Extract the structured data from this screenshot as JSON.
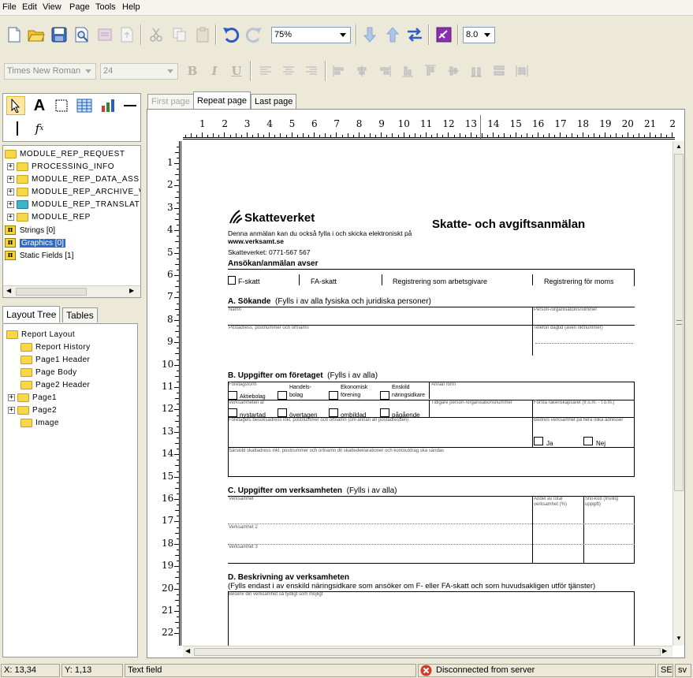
{
  "menu": [
    "File",
    "Edit",
    "View",
    "Page",
    "Tools",
    "Help"
  ],
  "toolbar": {
    "zoom": "75%",
    "version": "8.0"
  },
  "format": {
    "font": "Times New Roman",
    "size": "24",
    "bold": "B",
    "italic": "I",
    "underline": "U"
  },
  "tree": {
    "root": "MODULE_REP_REQUEST",
    "items": [
      "PROCESSING_INFO",
      "MODULE_REP_DATA_ASS",
      "MODULE_REP_ARCHIVE_V",
      "MODULE_REP_TRANSLAT",
      "MODULE_REP"
    ],
    "strings": "Strings [0]",
    "graphics": "Graphics [0]",
    "static": "Static Fields [1]"
  },
  "lowertabs": [
    "Layout Tree",
    "Tables"
  ],
  "layout": {
    "root": "Report Layout",
    "items": [
      "Report History",
      "Page1 Header",
      "Page Body",
      "Page2 Header",
      "Page1",
      "Page2",
      "Image"
    ]
  },
  "pagetabs": [
    "First page",
    "Repeat page",
    "Last page"
  ],
  "ruler_h": [
    "1",
    "2",
    "3",
    "4",
    "5",
    "6",
    "7",
    "8",
    "9",
    "10",
    "11",
    "12",
    "13",
    "14",
    "15",
    "16",
    "17",
    "18",
    "19",
    "20",
    "21",
    "2"
  ],
  "ruler_v": [
    "1",
    "2",
    "3",
    "4",
    "5",
    "6",
    "7",
    "8",
    "9",
    "10",
    "11",
    "12",
    "13",
    "14",
    "15",
    "16",
    "17",
    "18",
    "19",
    "20",
    "21",
    "22"
  ],
  "form": {
    "logo": "Skatteverket",
    "title": "Skatte- och avgiftsanmälan",
    "intro1": "Denna anmälan kan du också fylla i och skicka elektroniskt på",
    "intro2": "www.verksamt.se",
    "intro3": "Skatteverket: 0771-567 567",
    "purpose": "Ansökan/anmälan avser",
    "opts": [
      "F-skatt",
      "FA-skatt",
      "Registrering som arbetsgivare",
      "Registrering för moms"
    ],
    "secA": "A.  Sökande",
    "secA_sub": "(Fylls i av alla fysiska och juridiska personer)",
    "namn": "Namn",
    "pnr": "Person-/organisationsnummer",
    "addr": "Postadress, postnummer och ortnamn",
    "tel": "Telefon dagtid (även riktnummer)",
    "secB": "B.  Uppgifter om företaget",
    "secB_sub": "(Fylls i av alla)",
    "ftype": "Företagsform",
    "ab": "Aktiebolag",
    "hb1": "Handels-",
    "hb2": "bolag",
    "ef1": "Ekonomisk",
    "ef2": "förening",
    "en1": "Enskild",
    "en2": "näringsidkare",
    "annan": "Annan form",
    "vhar": "Verksamheten är",
    "ny": "nystartad",
    "ov": "övertagen",
    "om": "ombildad",
    "pag": "pågående",
    "tidigare": "Tidigare person-/organisationsnummer",
    "forsta": "Första räkenskapsåret (fr.o.m. - t.o.m.)",
    "besok": "Företagets besöksadress inkl. postnummer och ortnamn (om annan än postadressen)",
    "bedriv": "Bedrivs verksamhet på flera olika adresser",
    "ja": "Ja",
    "nej": "Nej",
    "sarskild": "Särskild skattadress inkl. postnummer och ortnamn dit skattedeklarationer och kontoutdrag ska sändas",
    "secC": "C.  Uppgifter om verksamheten",
    "secC_sub": "(Fylls i av alla)",
    "verks": "Verksamhet",
    "andel1": "Andel av total",
    "andel2": "verksamhet (%)",
    "sni1": "SNI-kod (frivillig",
    "sni2": "uppgift)",
    "v2": "Verksamhet 2",
    "v3": "Verksamhet 3",
    "secD": "D.  Beskrivning av verksamheten",
    "secD_sub": "(Fylls endast i av enskild näringsidkare som ansöker om F- eller FA-skatt och som huvudsakligen utför tjänster)",
    "beskriv": "Beskriv din verksamhet så tydligt som möjligt"
  },
  "status": {
    "x": "X: 13,34",
    "y": "Y: 1,13",
    "field": "Text field",
    "conn": "Disconnected from server",
    "c1": "SE",
    "c2": "sv"
  }
}
